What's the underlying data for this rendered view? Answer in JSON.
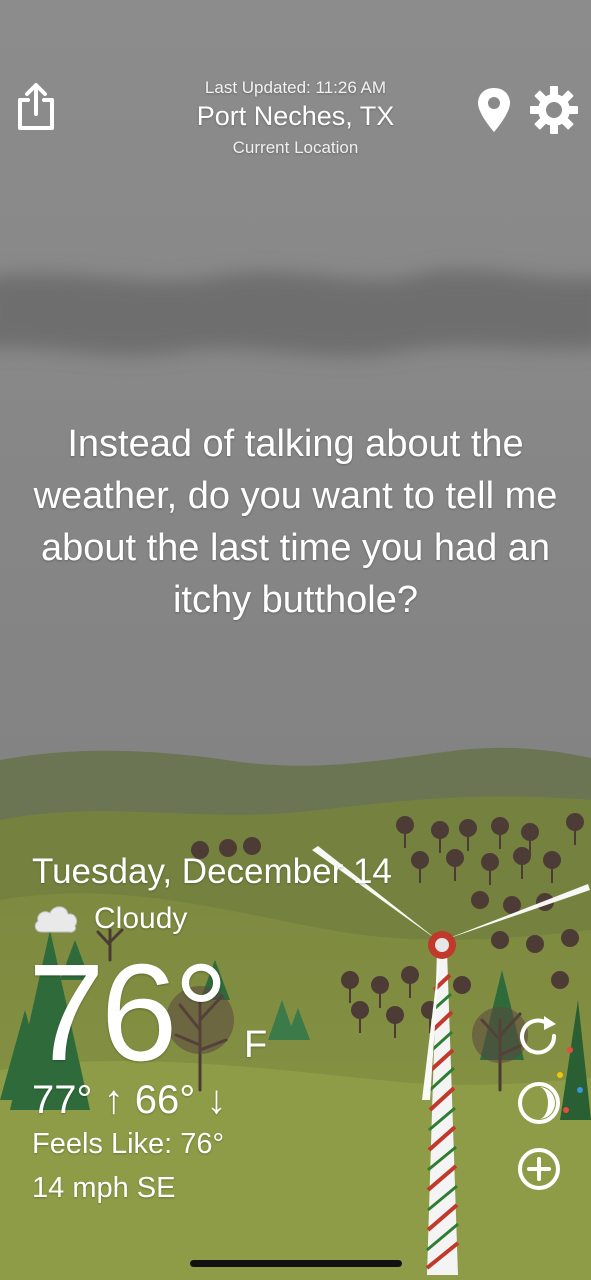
{
  "header": {
    "last_updated": "Last Updated: 11:26 AM",
    "location": "Port Neches, TX",
    "location_sub": "Current Location"
  },
  "message": "Instead of talking about the weather, do you want to tell me about the last time you had an itchy butthole?",
  "weather": {
    "date": "Tuesday, December 14",
    "condition": "Cloudy",
    "condition_icon": "cloud-icon",
    "temperature": "76°",
    "unit": "F",
    "hi_lo": "77° ↑  66° ↓",
    "feels_like": "Feels Like: 76°",
    "wind": "14 mph SE"
  },
  "icons": {
    "share": "share-icon",
    "pin": "location-pin-icon",
    "settings": "gear-icon",
    "refresh": "refresh-icon",
    "moon": "moon-phase-icon",
    "add": "add-circle-icon"
  },
  "colors": {
    "sky": "#8a8a8a",
    "hills_far": "#6f7a50",
    "hills_near": "#7b8a3c",
    "tree_green": "#2f6b3a",
    "turbine_red": "#c0392b",
    "text": "#ffffff"
  }
}
